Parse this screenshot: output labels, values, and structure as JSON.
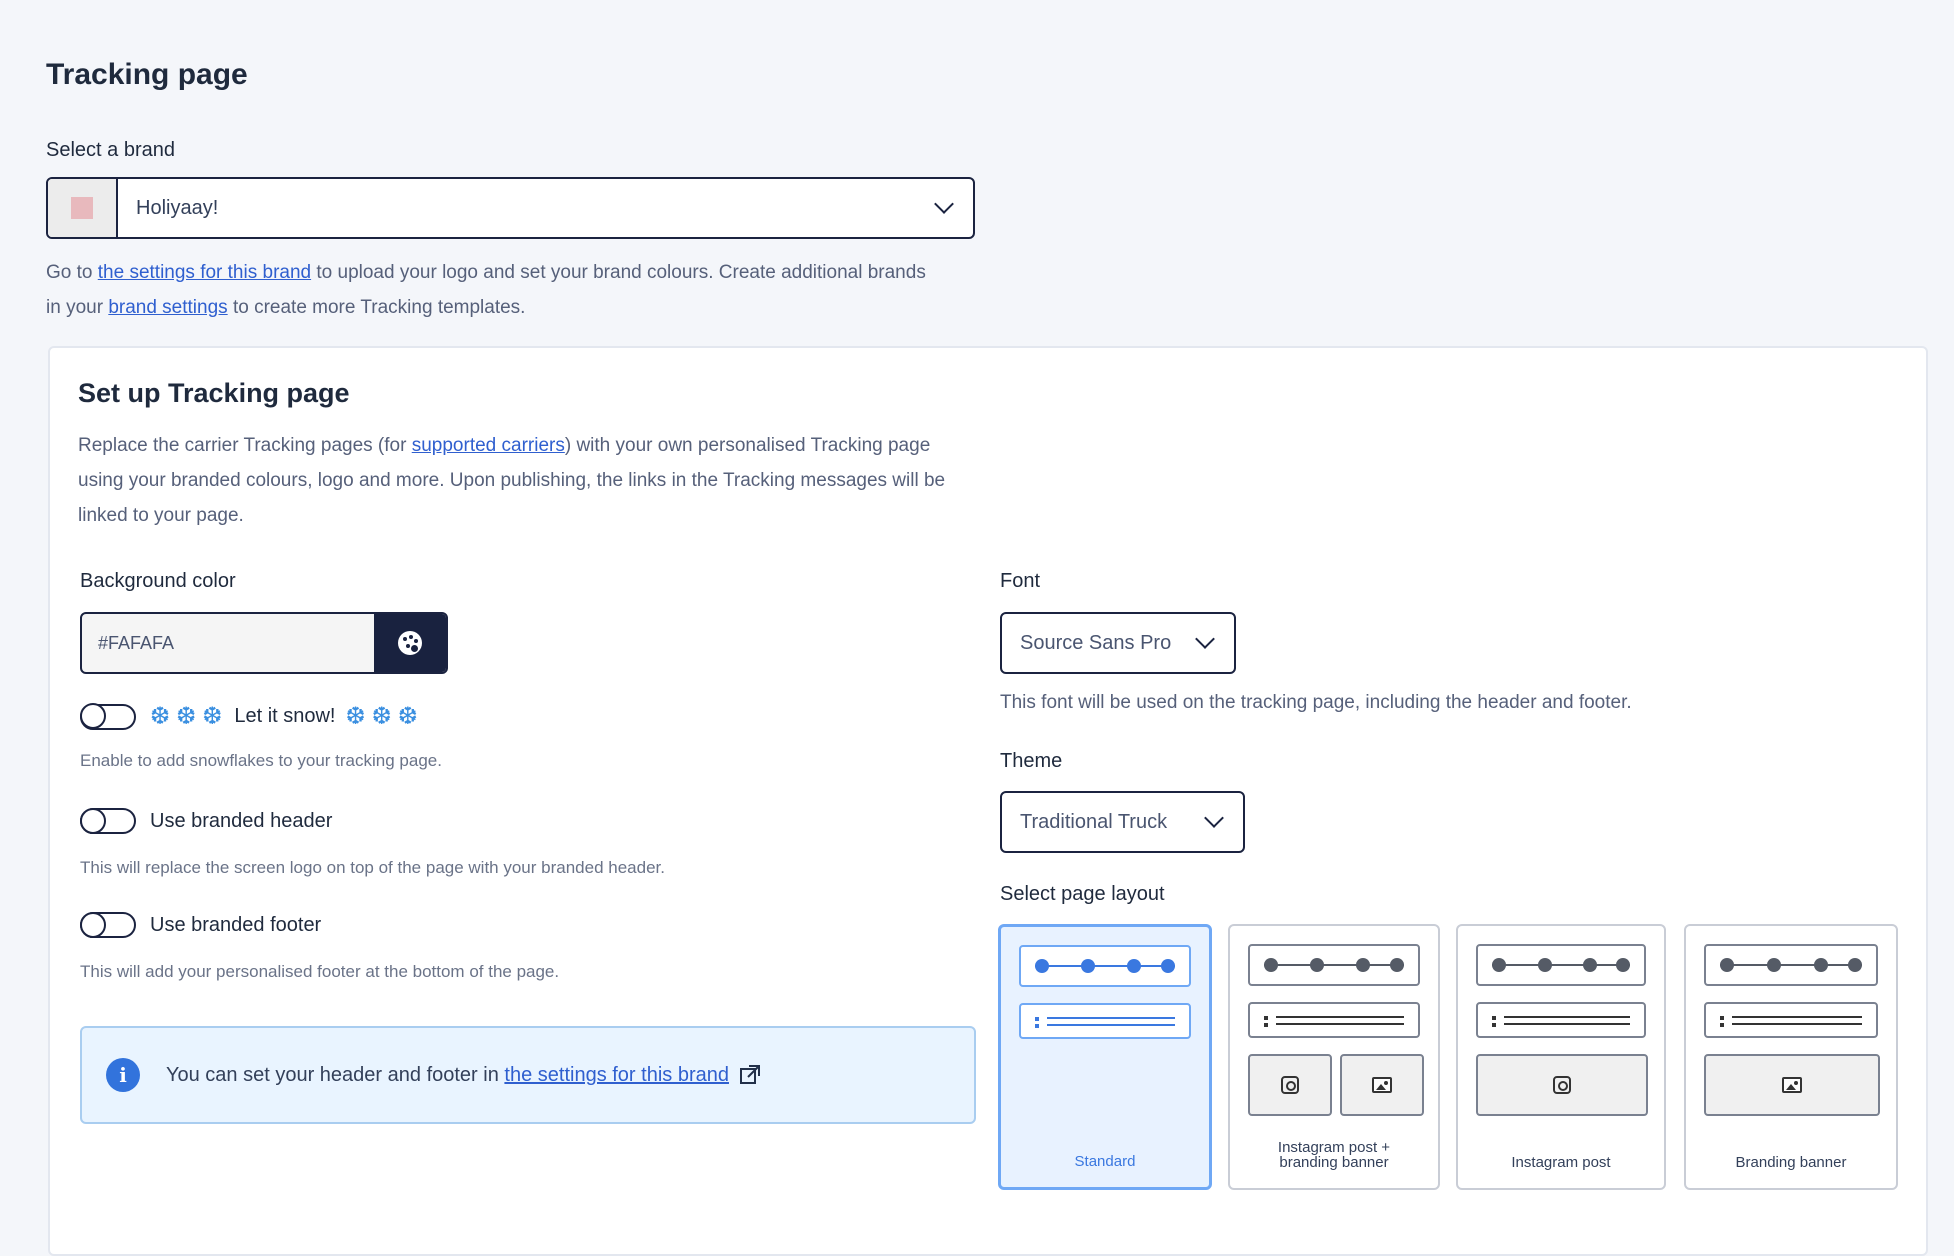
{
  "page": {
    "title": "Tracking page"
  },
  "brand": {
    "label": "Select a brand",
    "selected": "Holiyaay!",
    "swatch_color": "#e8b9bd",
    "help_prefix": "Go to ",
    "help_link1": "the settings for this brand",
    "help_mid": " to upload your logo and set your brand colours. Create additional brands in your ",
    "help_link2": "brand settings",
    "help_suffix": " to create more Tracking templates."
  },
  "setup": {
    "title": "Set up Tracking page",
    "desc_prefix": "Replace the carrier Tracking pages (for ",
    "desc_link": "supported carriers",
    "desc_suffix": ") with your own personalised Tracking page using your branded colours, logo and more. Upon publishing, the links in the Tracking messages will be linked to your page."
  },
  "background": {
    "label": "Background color",
    "value": "#FAFAFA"
  },
  "toggles": {
    "snow": {
      "snow_left": "❆❆❆",
      "label": "Let it snow!",
      "snow_right": "❆❆❆",
      "help": "Enable to add snowflakes to your tracking page.",
      "on": false
    },
    "header": {
      "label": "Use branded header",
      "help": "This will replace the screen logo on top of the page with your branded header.",
      "on": false
    },
    "footer": {
      "label": "Use branded footer",
      "help": "This will add your personalised footer at the bottom of the page.",
      "on": false
    }
  },
  "info": {
    "text": "You can set your header and footer in ",
    "link": "the settings for this brand"
  },
  "font": {
    "label": "Font",
    "value": "Source Sans Pro",
    "help": "This font will be used on the tracking page, including the header and footer."
  },
  "theme": {
    "label": "Theme",
    "value": "Traditional Truck"
  },
  "layout": {
    "label": "Select page layout",
    "options": [
      {
        "label": "Standard",
        "selected": true
      },
      {
        "label": "Instagram post + branding banner",
        "selected": false
      },
      {
        "label": "Instagram post",
        "selected": false
      },
      {
        "label": "Branding banner",
        "selected": false
      }
    ]
  },
  "colors": {
    "accent": "#3273dc",
    "dark": "#19223f",
    "info_bg": "#e9f4ff"
  }
}
